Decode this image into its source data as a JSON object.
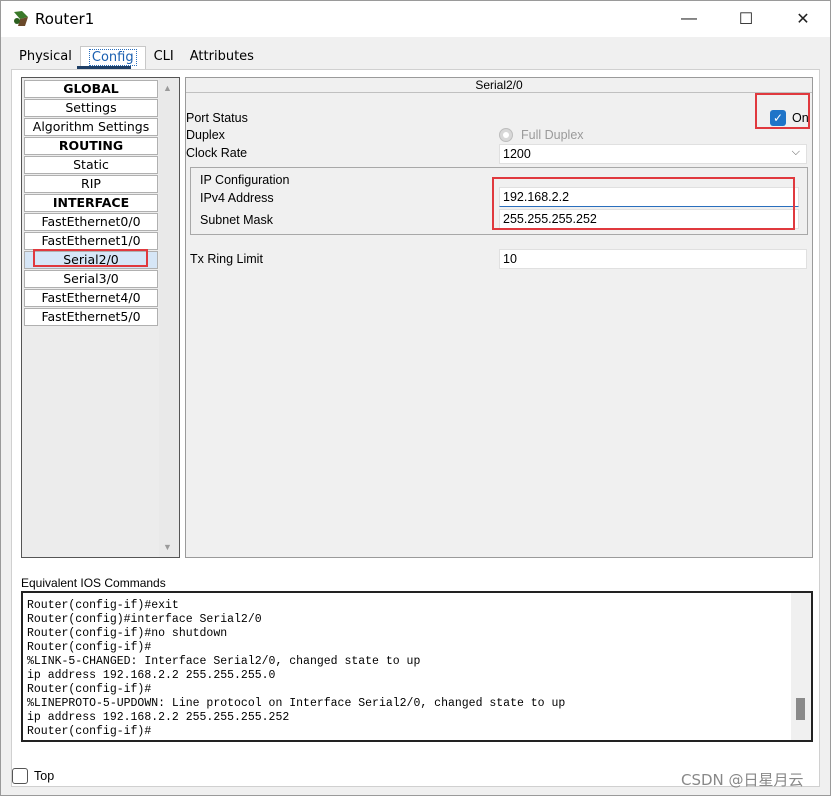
{
  "window": {
    "title": "Router1",
    "minimize": "—",
    "maximize": "☐",
    "close": "✕"
  },
  "tabs": [
    "Physical",
    "Config",
    "CLI",
    "Attributes"
  ],
  "sidebar": {
    "items": [
      {
        "label": "GLOBAL",
        "header": true
      },
      {
        "label": "Settings"
      },
      {
        "label": "Algorithm Settings"
      },
      {
        "label": "ROUTING",
        "header": true
      },
      {
        "label": "Static"
      },
      {
        "label": "RIP"
      },
      {
        "label": "INTERFACE",
        "header": true
      },
      {
        "label": "FastEthernet0/0"
      },
      {
        "label": "FastEthernet1/0"
      },
      {
        "label": "Serial2/0",
        "selected": true
      },
      {
        "label": "Serial3/0"
      },
      {
        "label": "FastEthernet4/0"
      },
      {
        "label": "FastEthernet5/0"
      }
    ]
  },
  "interface": {
    "title": "Serial2/0",
    "port_status_label": "Port Status",
    "port_status_value": "On",
    "duplex_label": "Duplex",
    "duplex_value": "Full Duplex",
    "clock_rate_label": "Clock Rate",
    "clock_rate_value": "1200",
    "ip_config_label": "IP Configuration",
    "ipv4_label": "IPv4 Address",
    "ipv4_value": "192.168.2.2",
    "mask_label": "Subnet Mask",
    "mask_value": "255.255.255.252",
    "tx_ring_label": "Tx Ring Limit",
    "tx_ring_value": "10"
  },
  "ios": {
    "label": "Equivalent IOS Commands",
    "lines": [
      "Router(config-if)#exit",
      "Router(config)#interface Serial2/0",
      "Router(config-if)#no shutdown",
      "Router(config-if)#",
      "%LINK-5-CHANGED: Interface Serial2/0, changed state to up",
      "ip address 192.168.2.2 255.255.255.0",
      "Router(config-if)#",
      "%LINEPROTO-5-UPDOWN: Line protocol on Interface Serial2/0, changed state to up",
      "ip address 192.168.2.2 255.255.255.252",
      "Router(config-if)#"
    ]
  },
  "footer": {
    "top_label": "Top",
    "watermark": "CSDN @日星月云"
  },
  "colors": {
    "highlight_red": "#e0393e",
    "checkbox_blue": "#1f74c8",
    "selected_item": "#d6e6f7"
  }
}
